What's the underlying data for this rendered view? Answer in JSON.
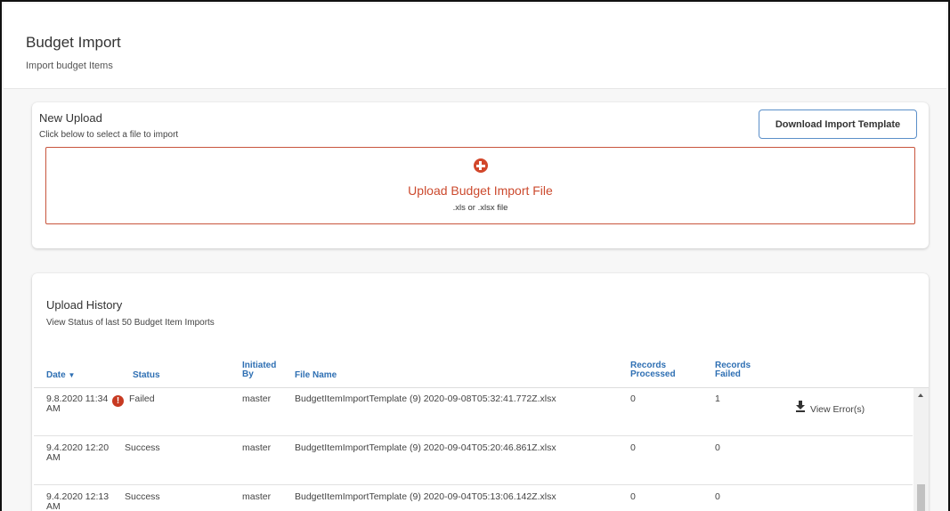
{
  "header": {
    "title": "Budget Import",
    "subtitle": "Import budget Items"
  },
  "upload": {
    "title": "New Upload",
    "subtitle": "Click below to select a file to import",
    "download_button": "Download Import Template",
    "dropzone_title": "Upload Budget Import File",
    "dropzone_sub": ".xls or .xlsx file"
  },
  "history": {
    "title": "Upload History",
    "subtitle": "View Status of last 50 Budget Item Imports",
    "columns": {
      "date": "Date",
      "status": "Status",
      "initiated_1": "Initiated",
      "initiated_2": "By",
      "file_name": "File Name",
      "processed_1": "Records",
      "processed_2": "Processed",
      "failed_1": "Records",
      "failed_2": "Failed"
    },
    "rows": [
      {
        "date_1": "9.8.2020 11:34",
        "date_2": "AM",
        "status": "Failed",
        "initiated_by": "master",
        "file_name": "BudgetItemImportTemplate (9) 2020-09-08T05:32:41.772Z.xlsx",
        "records_processed": "0",
        "records_failed": "1",
        "action": "View Error(s)"
      },
      {
        "date_1": "9.4.2020 12:20",
        "date_2": "AM",
        "status": "Success",
        "initiated_by": "master",
        "file_name": "BudgetItemImportTemplate (9) 2020-09-04T05:20:46.861Z.xlsx",
        "records_processed": "0",
        "records_failed": "0"
      },
      {
        "date_1": "9.4.2020 12:13",
        "date_2": "AM",
        "status": "Success",
        "initiated_by": "master",
        "file_name": "BudgetItemImportTemplate (9) 2020-09-04T05:13:06.142Z.xlsx",
        "records_processed": "0",
        "records_failed": "0"
      }
    ]
  },
  "colors": {
    "accent_red": "#cc4a2e",
    "link_blue": "#2e6fb3",
    "button_border": "#5b8fc9"
  },
  "icons": {
    "sort": "caret-down-icon",
    "add": "plus-circle-icon",
    "error": "exclamation-circle-icon",
    "download": "download-icon"
  }
}
